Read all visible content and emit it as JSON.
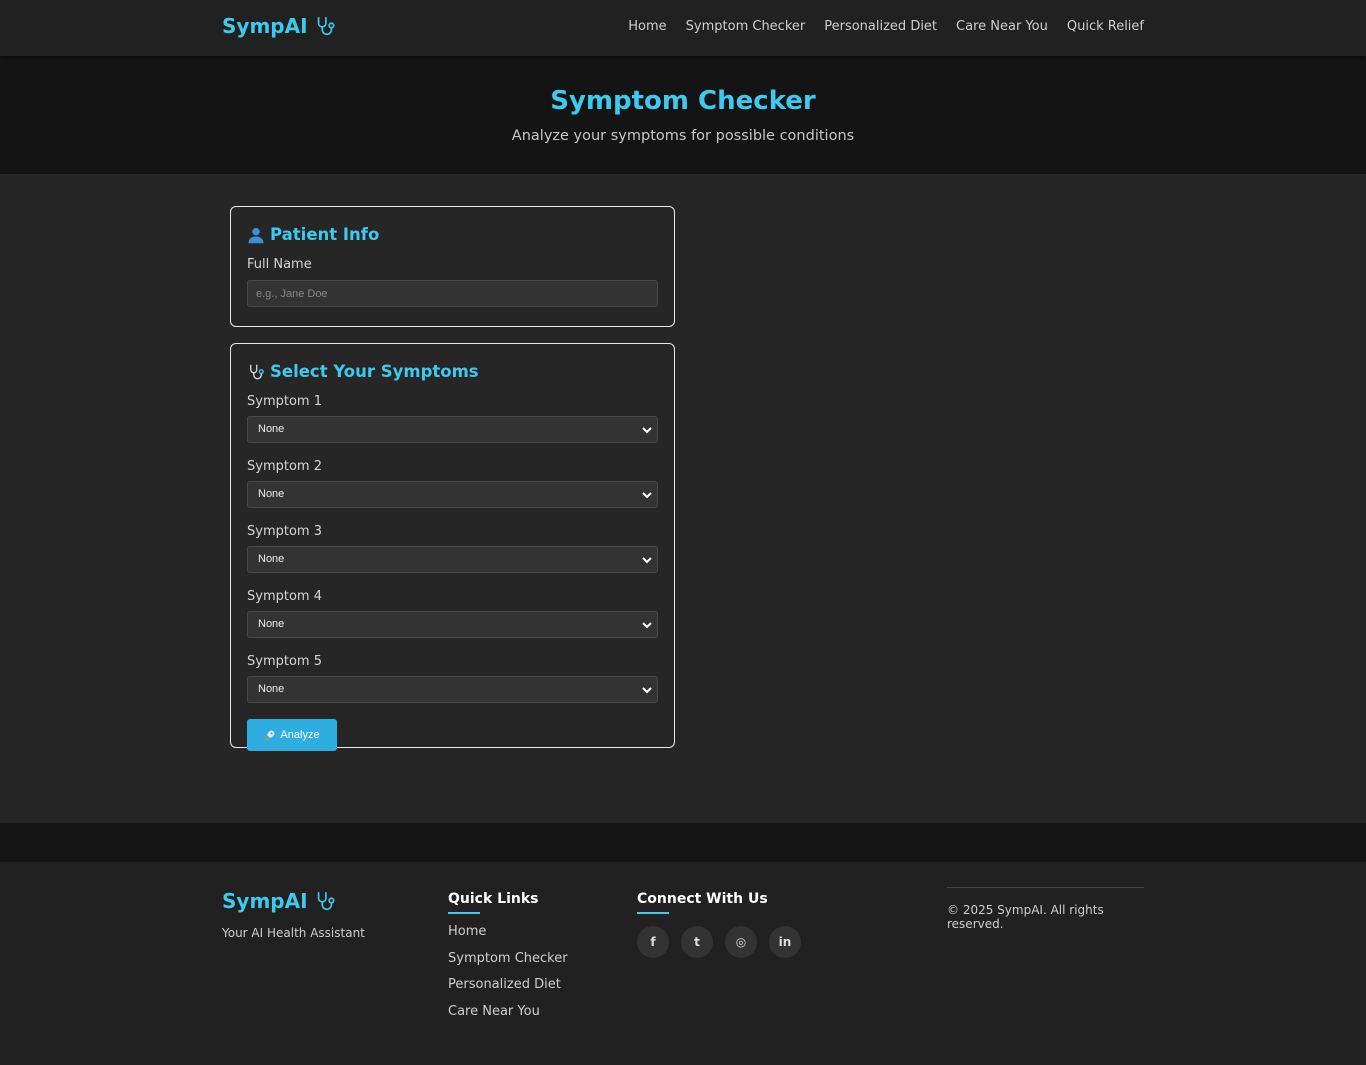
{
  "nav": {
    "brand": "SympAI",
    "links": [
      "Home",
      "Symptom Checker",
      "Personalized Diet",
      "Care Near You",
      "Quick Relief"
    ]
  },
  "hero": {
    "title": "Symptom Checker",
    "subtitle": "Analyze your symptoms for possible conditions"
  },
  "patient": {
    "title": "Patient Info",
    "name_label": "Full Name",
    "name_placeholder": "e.g., Jane Doe",
    "name_value": ""
  },
  "symptoms": {
    "title": "Select Your Symptoms",
    "fields": [
      {
        "label": "Symptom 1",
        "value": "None"
      },
      {
        "label": "Symptom 2",
        "value": "None"
      },
      {
        "label": "Symptom 3",
        "value": "None"
      },
      {
        "label": "Symptom 4",
        "value": "None"
      },
      {
        "label": "Symptom 5",
        "value": "None"
      }
    ],
    "analyze_label": "Analyze"
  },
  "footer": {
    "brand": "SympAI",
    "tagline": "Your AI Health Assistant",
    "quick_links_title": "Quick Links",
    "quick_links": [
      "Home",
      "Symptom Checker",
      "Personalized Diet",
      "Care Near You"
    ],
    "connect_title": "Connect With Us",
    "socials": [
      {
        "icon": "facebook-icon",
        "glyph": "f"
      },
      {
        "icon": "twitter-icon",
        "glyph": "t"
      },
      {
        "icon": "instagram-icon",
        "glyph": "◎"
      },
      {
        "icon": "linkedin-icon",
        "glyph": "in"
      }
    ],
    "copyright": "© 2025 SympAI. All rights reserved."
  },
  "colors": {
    "accent": "#3ec9ef",
    "button": "#2eaee0",
    "background": "#262626",
    "navbar": "#212121"
  }
}
